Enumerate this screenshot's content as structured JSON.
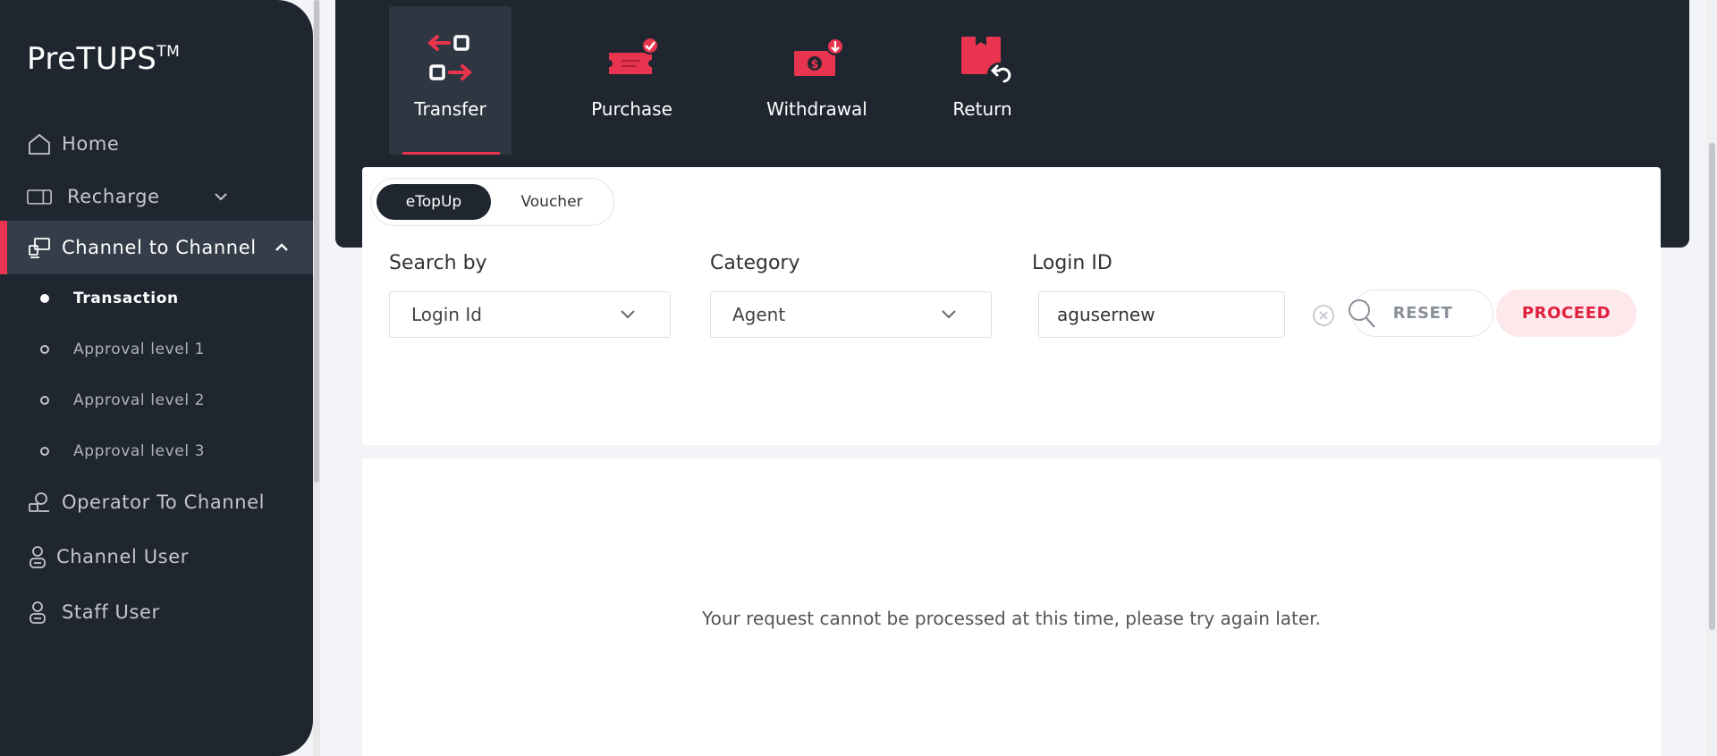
{
  "sidebar": {
    "brand": "PreTUPS",
    "brand_mark": "TM",
    "items": [
      {
        "label": "Home",
        "icon": "home-icon"
      },
      {
        "label": "Recharge",
        "icon": "ticket-icon"
      },
      {
        "label": "Channel to Channel",
        "icon": "channel-transfer-icon"
      },
      {
        "label": "Operator To Channel",
        "icon": "operator-icon"
      },
      {
        "label": "Channel User",
        "icon": "user-icon"
      },
      {
        "label": "Staff User",
        "icon": "staff-icon"
      }
    ],
    "sub_items": [
      {
        "label": "Transaction"
      },
      {
        "label": "Approval level 1"
      },
      {
        "label": "Approval level 2"
      },
      {
        "label": "Approval level 3"
      }
    ]
  },
  "tabs": [
    {
      "label": "Transfer",
      "icon": "transfer-icon"
    },
    {
      "label": "Purchase",
      "icon": "purchase-icon"
    },
    {
      "label": "Withdrawal",
      "icon": "withdrawal-icon"
    },
    {
      "label": "Return",
      "icon": "return-icon"
    }
  ],
  "toggle": {
    "on": "eTopUp",
    "off": "Voucher"
  },
  "form": {
    "search_by_label": "Search by",
    "search_by_value": "Login Id",
    "category_label": "Category",
    "category_value": "Agent",
    "login_id_label": "Login ID",
    "login_id_value": "agusernew",
    "reset_label": "RESET",
    "proceed_label": "PROCEED"
  },
  "message": "Your request cannot be processed at this time, please try again later.",
  "colors": {
    "accent": "#e8344e",
    "dark": "#1f2630",
    "proceed_bg": "#fde8eb"
  }
}
